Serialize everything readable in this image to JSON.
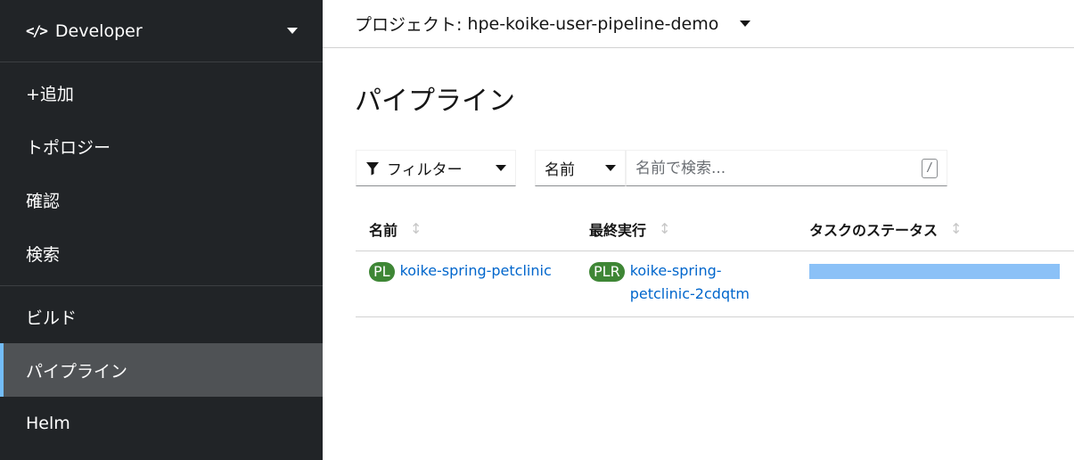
{
  "sidebar": {
    "perspective": {
      "icon": "code-icon",
      "label": "Developer"
    },
    "group1": [
      {
        "label": "+追加"
      },
      {
        "label": "トポロジー"
      },
      {
        "label": "確認"
      },
      {
        "label": "検索"
      }
    ],
    "group2": [
      {
        "label": "ビルド"
      },
      {
        "label": "パイプライン",
        "active": true
      },
      {
        "label": "Helm"
      }
    ]
  },
  "project": {
    "label": "プロジェクト:",
    "value": "hpe-koike-user-pipeline-demo"
  },
  "page_title": "パイプライン",
  "toolbar": {
    "filter_label": "フィルター",
    "name_select": "名前",
    "search_placeholder": "名前で検索...",
    "shortcut_key": "/"
  },
  "table": {
    "headers": [
      "名前",
      "最終実行",
      "タスクのステータス"
    ],
    "rows": [
      {
        "name_badge": "PL",
        "name": "koike-spring-petclinic",
        "last_run_badge": "PLR",
        "last_run": "koike-spring-petclinic-2cdqtm",
        "task_status_color": "#8bc1f7"
      }
    ]
  },
  "colors": {
    "sidebar_bg": "#212427",
    "active_bg": "#4f5255",
    "active_border": "#73bcf7",
    "link": "#0066cc",
    "badge_green": "#3e8635"
  }
}
